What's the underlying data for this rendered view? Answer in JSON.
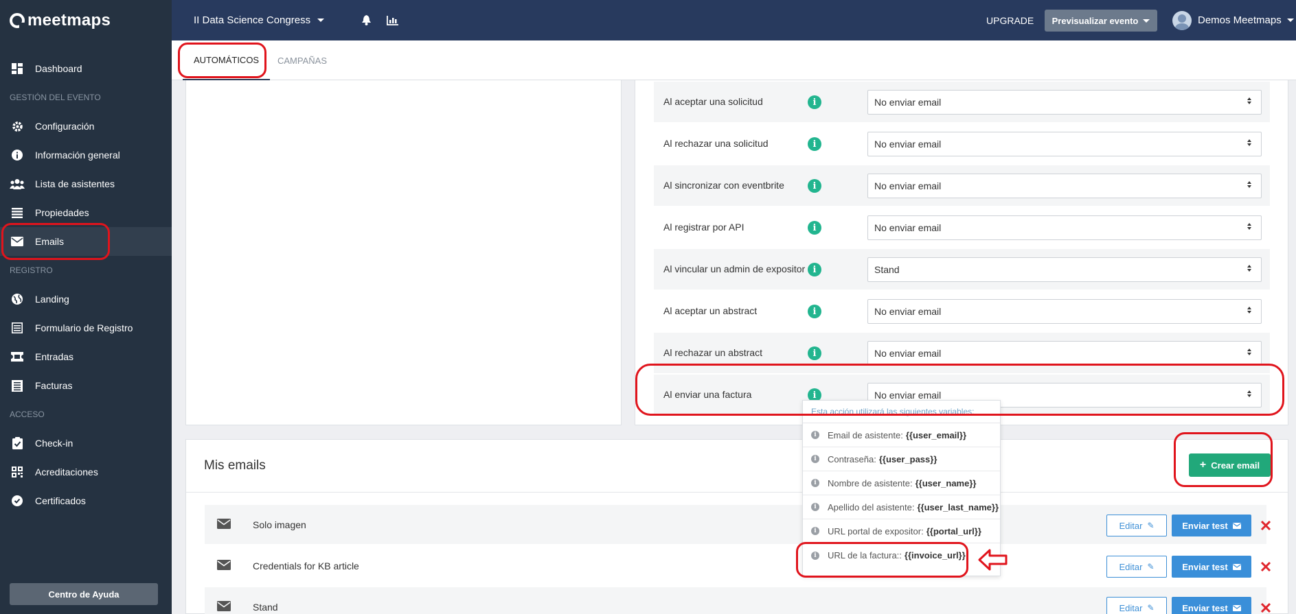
{
  "sidebar": {
    "logo": "meetmaps",
    "help_button": "Centro de Ayuda",
    "items": [
      {
        "label": "Dashboard"
      },
      {
        "section": "Gestión del evento"
      },
      {
        "label": "Configuración"
      },
      {
        "label": "Información general"
      },
      {
        "label": "Lista de asistentes"
      },
      {
        "label": "Propiedades"
      },
      {
        "label": "Emails",
        "active": true
      },
      {
        "section": "Registro"
      },
      {
        "label": "Landing"
      },
      {
        "label": "Formulario de Registro"
      },
      {
        "label": "Entradas"
      },
      {
        "label": "Facturas"
      },
      {
        "section": "Acceso"
      },
      {
        "label": "Check-in"
      },
      {
        "label": "Acreditaciones"
      },
      {
        "label": "Certificados"
      }
    ]
  },
  "topbar": {
    "event_name": "II Data Science Congress",
    "upgrade": "UPGRADE",
    "preview": "Previsualizar evento",
    "user": "Demos Meetmaps"
  },
  "tabs": [
    {
      "label": "Automáticos",
      "active": true
    },
    {
      "label": "Campañas",
      "active": false
    }
  ],
  "auto_rows": [
    {
      "label": "Al aceptar una solicitud",
      "value": "No enviar email"
    },
    {
      "label": "Al rechazar una solicitud",
      "value": "No enviar email"
    },
    {
      "label": "Al sincronizar con eventbrite",
      "value": "No enviar email"
    },
    {
      "label": "Al registrar por API",
      "value": "No enviar email"
    },
    {
      "label": "Al vincular un admin de expositor",
      "value": "Stand"
    },
    {
      "label": "Al aceptar un abstract",
      "value": "No enviar email"
    },
    {
      "label": "Al rechazar un abstract",
      "value": "No enviar email"
    },
    {
      "label": "Al enviar una factura",
      "value": "No enviar email"
    }
  ],
  "popover": {
    "header": "Esta acción utilizará las siguientes variables:",
    "items": [
      {
        "label": "Email de asistente:",
        "var": "{{user_email}}"
      },
      {
        "label": "Contraseña:",
        "var": "{{user_pass}}"
      },
      {
        "label": "Nombre de asistente:",
        "var": "{{user_name}}"
      },
      {
        "label": "Apellido del asistente:",
        "var": "{{user_last_name}}"
      },
      {
        "label": "URL portal de expositor:",
        "var": "{{portal_url}}"
      },
      {
        "label": "URL de la factura::",
        "var": "{{invoice_url}}"
      }
    ]
  },
  "mis_emails": {
    "title": "Mis emails",
    "create_button": "Crear email",
    "edit_label": "Editar",
    "test_label": "Enviar test",
    "rows": [
      {
        "name": "Solo imagen"
      },
      {
        "name": "Credentials for KB article"
      },
      {
        "name": "Stand"
      }
    ]
  },
  "colors": {
    "sidebar_bg": "#253241",
    "topbar_bg": "#283a5e",
    "accent_green": "#22b58f",
    "accent_blue": "#3a8fd9",
    "annotation_red": "#e0141c"
  }
}
